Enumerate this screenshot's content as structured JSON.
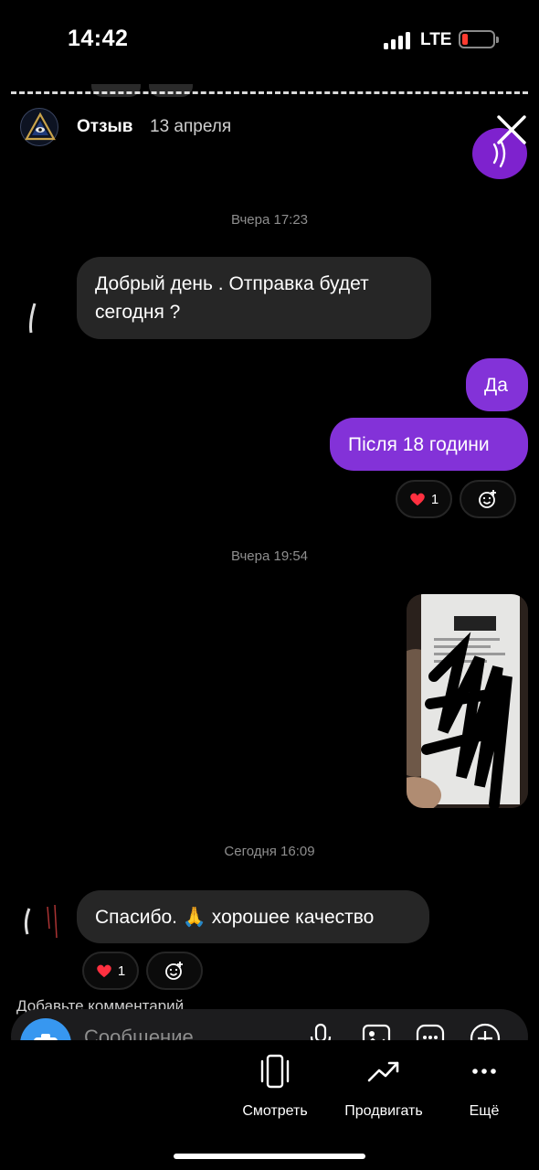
{
  "status_bar": {
    "time": "14:42",
    "network": "LTE"
  },
  "story_header": {
    "author": "Отзыв",
    "date": "13 апреля"
  },
  "chat": {
    "timestamps": [
      "Вчера 17:23",
      "Вчера 19:54",
      "Сегодня 16:09"
    ],
    "messages": [
      {
        "direction": "in",
        "text_line1": "Добрый день . Отправка будет",
        "text_line2": "сегодня ?"
      },
      {
        "direction": "out",
        "text": "Да"
      },
      {
        "direction": "out",
        "text": "Після 18 години"
      },
      {
        "direction": "in",
        "text": "Спасибо. 🙏 хорошее качество"
      }
    ],
    "reactions": [
      {
        "emoji": "heart",
        "count": "1"
      },
      {
        "emoji": "heart",
        "count": "1"
      }
    ]
  },
  "comment_hint": "Добавьте комментарий…",
  "composer": {
    "placeholder": "Сообщение"
  },
  "bottom_actions": [
    {
      "label": "Смотреть",
      "icon": "phone-view-icon"
    },
    {
      "label": "Продвигать",
      "icon": "trend-up-icon"
    },
    {
      "label": "Ещё",
      "icon": "more-icon"
    }
  ],
  "colors": {
    "outgoing_bubble": "#8332d8",
    "incoming_bubble": "#262626",
    "accent_blue": "#3797f0",
    "heart": "#ff3040",
    "battery_low": "#ff3b30"
  }
}
